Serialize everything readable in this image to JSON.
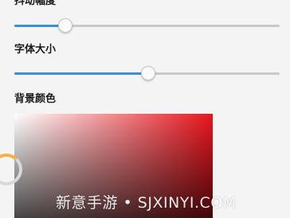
{
  "settings": {
    "shake_amplitude": {
      "label": "抖动幅度",
      "value": 0.19
    },
    "font_size": {
      "label": "字体大小",
      "value": 0.5
    },
    "background_color": {
      "label": "背景颜色",
      "hue_color": "#e8141c"
    }
  },
  "colors": {
    "accent": "#3a8fdc"
  },
  "watermark": "新意手游 • SJXINYI.COM"
}
